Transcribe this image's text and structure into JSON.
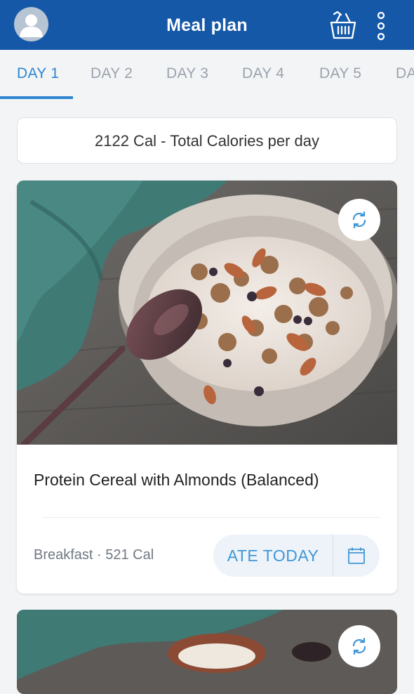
{
  "header": {
    "title": "Meal plan",
    "avatar_icon": "user-avatar-icon",
    "basket_icon": "shopping-basket-icon",
    "menu_icon": "more-vertical-icon"
  },
  "tabs": [
    {
      "label": "DAY 1",
      "active": true
    },
    {
      "label": "DAY 2"
    },
    {
      "label": "DAY 3"
    },
    {
      "label": "DAY 4"
    },
    {
      "label": "DAY 5"
    },
    {
      "label": "DA"
    }
  ],
  "summary": {
    "text": "2122 Cal - Total Calories per day"
  },
  "meals": [
    {
      "name": "Protein Cereal with Almonds (Balanced)",
      "meta": "Breakfast · 521 Cal",
      "ate_label": "ATE TODAY",
      "swap_icon": "swap-refresh-icon",
      "calendar_icon": "calendar-icon"
    }
  ],
  "colors": {
    "header": "#1558a8",
    "accent": "#2f86cf",
    "pill_bg": "#eef3f9"
  }
}
